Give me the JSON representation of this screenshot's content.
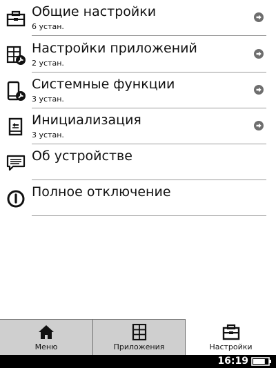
{
  "settings": {
    "items": [
      {
        "title": "Общие настройки",
        "subtitle": "6 устан.",
        "icon": "toolbox-icon",
        "has_arrow": true
      },
      {
        "title": "Настройки приложений",
        "subtitle": "2 устан.",
        "icon": "apps-wrench-icon",
        "has_arrow": true
      },
      {
        "title": "Системные функции",
        "subtitle": "3 устан.",
        "icon": "device-wrench-icon",
        "has_arrow": true
      },
      {
        "title": "Инициализация",
        "subtitle": "3 устан.",
        "icon": "reset-device-icon",
        "has_arrow": true
      },
      {
        "title": "Об устройстве",
        "subtitle": "",
        "icon": "info-speech-icon",
        "has_arrow": false
      },
      {
        "title": "Полное отключение",
        "subtitle": "",
        "icon": "power-icon",
        "has_arrow": false
      }
    ]
  },
  "tabs": [
    {
      "label": "Меню",
      "icon": "home-icon",
      "active": false
    },
    {
      "label": "Приложения",
      "icon": "applications-grid-icon",
      "active": false
    },
    {
      "label": "Настройки",
      "icon": "toolbox-icon",
      "active": true
    }
  ],
  "status": {
    "time": "16:19",
    "battery_level": 0.8
  },
  "colors": {
    "tab_inactive_bg": "#cfcfcf",
    "status_bar_bg": "#000000",
    "separator": "#9a9a9a"
  }
}
